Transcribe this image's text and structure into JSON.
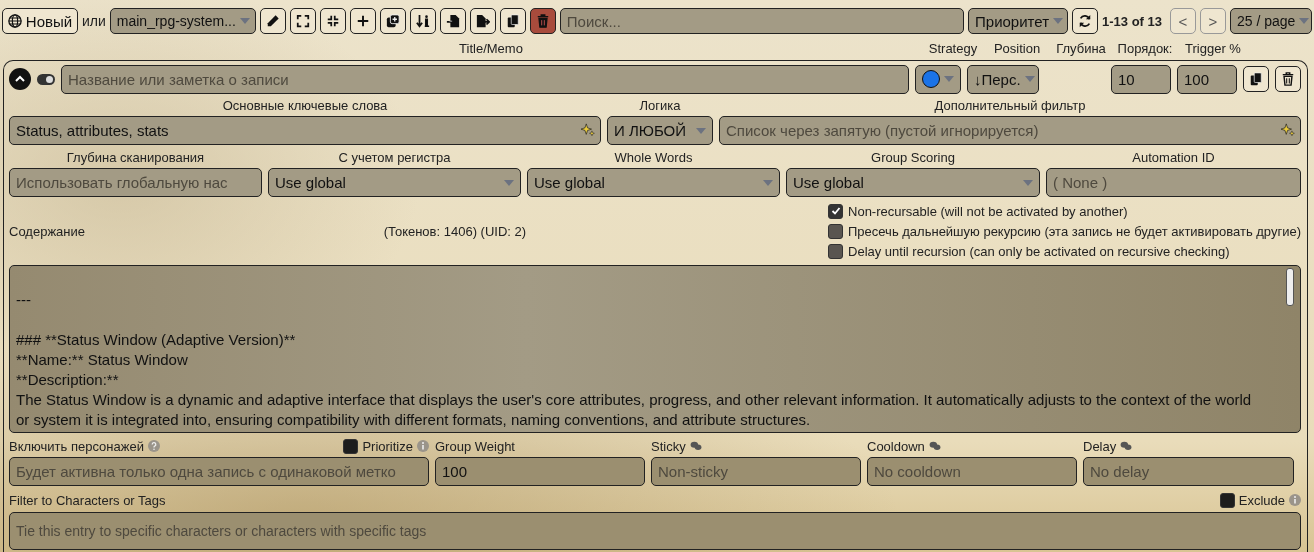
{
  "toolbar": {
    "new_button": "Новый",
    "or_label": "или",
    "book_select": "main_rpg-system...",
    "search": {
      "placeholder": "Поиск..."
    },
    "sort_select": "Приоритет",
    "pagination": "1-13 of 13",
    "prev_button": "<",
    "next_button": ">",
    "page_size": "25 / page"
  },
  "column_headers": [
    "Title/Memo",
    "Strategy",
    "Position",
    "Глубина",
    "Порядок:",
    "Trigger %"
  ],
  "entry": {
    "expanded": true,
    "enabled": true,
    "title": {
      "placeholder": "Название или заметка о записи"
    },
    "position": "↓Перс.",
    "order": "10",
    "trigger": "100",
    "keywords": {
      "label": "Основные ключевые слова",
      "value": "Status, attributes, stats"
    },
    "logic": {
      "label": "Логика",
      "value": "И ЛЮБОЙ"
    },
    "secondary_filter": {
      "label": "Дополнительный фильтр",
      "placeholder": "Список через запятую (пустой игнорируется)"
    },
    "settings": [
      {
        "label": "Глубина сканирования",
        "kind": "input",
        "placeholder": "Использовать глобальную нас"
      },
      {
        "label": "С учетом регистра",
        "kind": "select",
        "value": "Use global"
      },
      {
        "label": "Whole Words",
        "kind": "select",
        "value": "Use global"
      },
      {
        "label": "Group Scoring",
        "kind": "select",
        "value": "Use global"
      },
      {
        "label": "Automation ID",
        "kind": "input",
        "placeholder": "( None )"
      }
    ],
    "content_label": "Содержание",
    "token_info": "(Токенов:  1406)  (UID: 2)",
    "checkboxes": [
      {
        "label": "Non-recursable (will not be activated by another)",
        "checked": true
      },
      {
        "label": "Пресечь дальнейшую рекурсию (эта запись не будет активировать другие)",
        "checked": false
      },
      {
        "label": "Delay until recursion (can only be activated on recursive checking)",
        "checked": false
      }
    ],
    "content": "\n---\n\n### **Status Window (Adaptive Version)**\n**Name:** Status Window\n**Description:**\nThe Status Window is a dynamic and adaptive interface that displays the user's core attributes, progress, and other relevant information. It automatically adjusts to the context of the world or system it is integrated into, ensuring compatibility with different formats, naming conventions, and attribute structures.",
    "prioritize": {
      "label": "Prioritize",
      "checked": false
    },
    "bottom_fields": [
      {
        "label": "Включить персонажей",
        "placeholder": "Будет активна только одна запись с одинаковой метко"
      },
      {
        "label": "Group Weight",
        "value": "100"
      },
      {
        "label": "Sticky",
        "placeholder": "Non-sticky"
      },
      {
        "label": "Cooldown",
        "placeholder": "No cooldown"
      },
      {
        "label": "Delay",
        "placeholder": "No delay"
      }
    ],
    "filter": {
      "label": "Filter to Characters or Tags",
      "placeholder": "Tie this entry to specific characters or characters with specific tags"
    },
    "exclude": {
      "label": "Exclude",
      "checked": false
    }
  }
}
